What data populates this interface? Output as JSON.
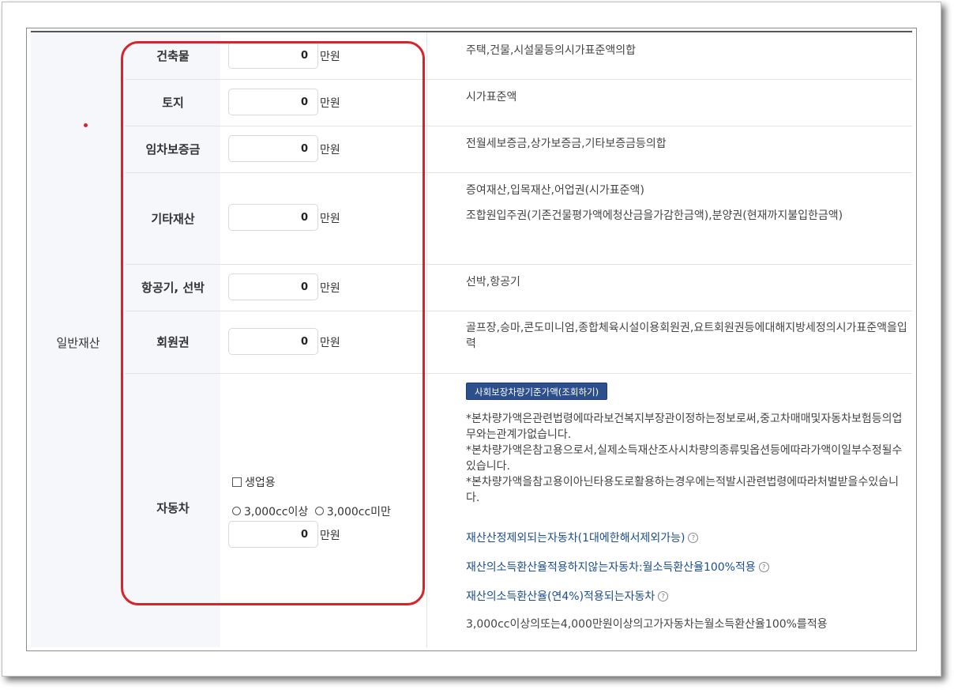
{
  "category": "일반재산",
  "unit": "만원",
  "rows": [
    {
      "label": "건축물",
      "value": "0",
      "desc": "주택,건물,시설물등의시가표준액의합"
    },
    {
      "label": "토지",
      "value": "0",
      "desc": "시가표준액"
    },
    {
      "label": "임차보증금",
      "value": "0",
      "desc": "전월세보증금,상가보증금,기타보증금등의합"
    },
    {
      "label": "기타재산",
      "value": "0",
      "desc": "증여재산,입목재산,어업권(시가표준액)",
      "desc2": "조합원입주권(기존건물평가액에청산금을가감한금액),분양권(현재까지불입한금액)"
    },
    {
      "label": "항공기, 선박",
      "value": "0",
      "desc": "선박,항공기"
    },
    {
      "label": "회원권",
      "value": "0",
      "desc": "골프장,승마,콘도미니엄,종합체육시설이용회원권,요트회원권등에대해지방세정의시가표준액을입력"
    }
  ],
  "car": {
    "label": "자동차",
    "value": "0",
    "business_use": "생업용",
    "option_over": "3,000cc이상",
    "option_under": "3,000cc미만",
    "button": "사회보장차량기준가액(조회하기)",
    "note": "*본차량가액은관련법령에따라보건복지부장관이정하는정보로써,중고차매매및자동차보험등의업무와는관계가없습니다.\n*본차량가액은참고용으로서,실제소득재산조사시차량의종류및옵션등에따라가액이일부수정될수있습니다.\n*본차량가액을참고용이아닌타용도로활용하는경우에는적발시관련법령에따라처벌받을수있습니다.",
    "link1": "재산산정제외되는자동차(1대에한해서제외가능)",
    "link2": "재산의소득환산율적용하지않는자동차:월소득환산율100%적용",
    "link3": "재산의소득환산율(연4%)적용되는자동차",
    "footer": "3,000cc이상의또는4,000만원이상의고가자동차는월소득환산율100%를적용"
  }
}
